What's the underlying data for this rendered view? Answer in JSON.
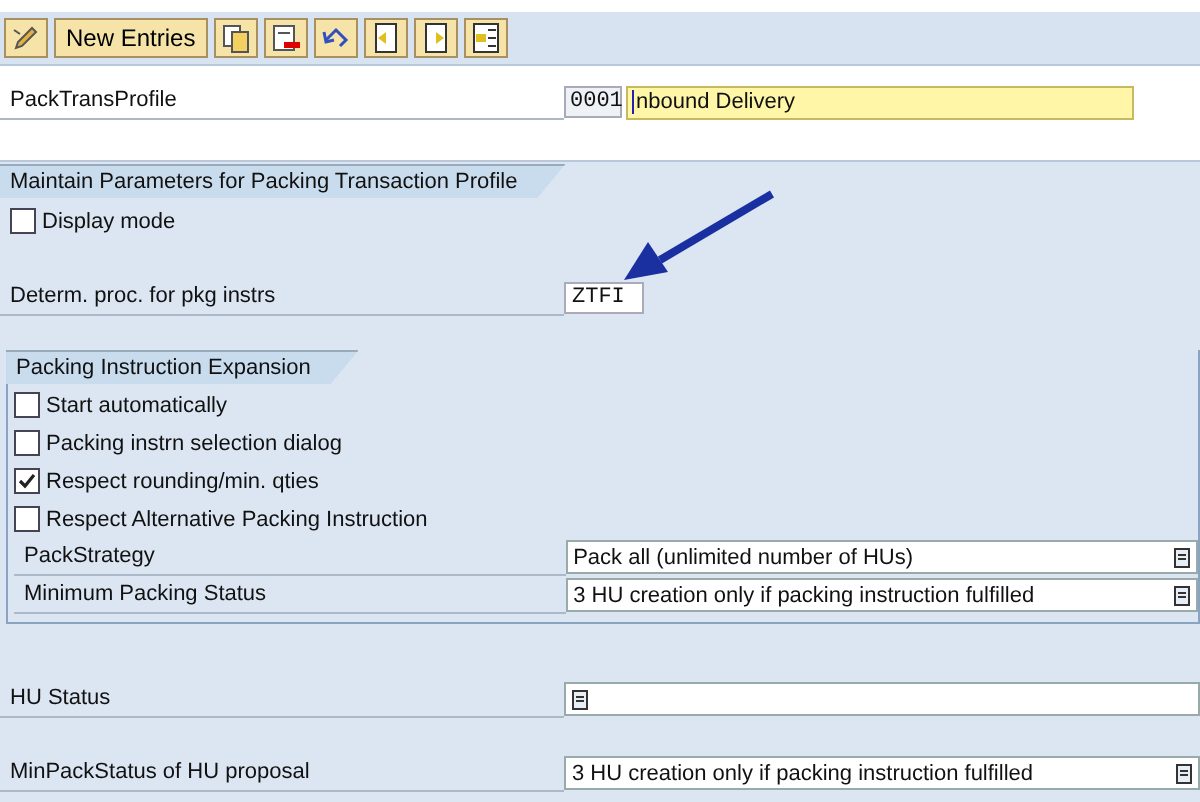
{
  "toolbar": {
    "buttons": [
      {
        "kind": "icon"
      },
      {
        "kind": "text",
        "label": "New Entries"
      },
      {
        "kind": "icon"
      },
      {
        "kind": "icon"
      },
      {
        "kind": "icon"
      },
      {
        "kind": "icon"
      },
      {
        "kind": "icon"
      },
      {
        "kind": "icon"
      }
    ]
  },
  "header": {
    "label": "PackTransProfile",
    "code": "0001",
    "description": "nbound Delivery"
  },
  "parameters": {
    "title": "Maintain Parameters for Packing Transaction Profile",
    "display_mode": {
      "label": "Display mode",
      "checked": false
    },
    "determ": {
      "label": "Determ. proc. for pkg instrs",
      "value": "ZTFI"
    }
  },
  "expansion": {
    "title": "Packing Instruction Expansion",
    "checkboxes": [
      {
        "label": "Start automatically",
        "checked": false
      },
      {
        "label": "Packing instrn selection dialog",
        "checked": false
      },
      {
        "label": "Respect rounding/min. qties",
        "checked": true
      },
      {
        "label": "Respect Alternative Packing Instruction",
        "checked": false
      }
    ],
    "dropdowns": [
      {
        "label": "PackStrategy",
        "value": " Pack all (unlimited number of HUs)"
      },
      {
        "label": "Minimum Packing Status",
        "value": "3 HU creation only if packing instruction fulfilled"
      }
    ]
  },
  "status_fields": [
    {
      "label": "HU Status"
    },
    {
      "label": "MinPackStatus of HU proposal",
      "value": "3 HU creation only if packing instruction fulfilled"
    }
  ]
}
